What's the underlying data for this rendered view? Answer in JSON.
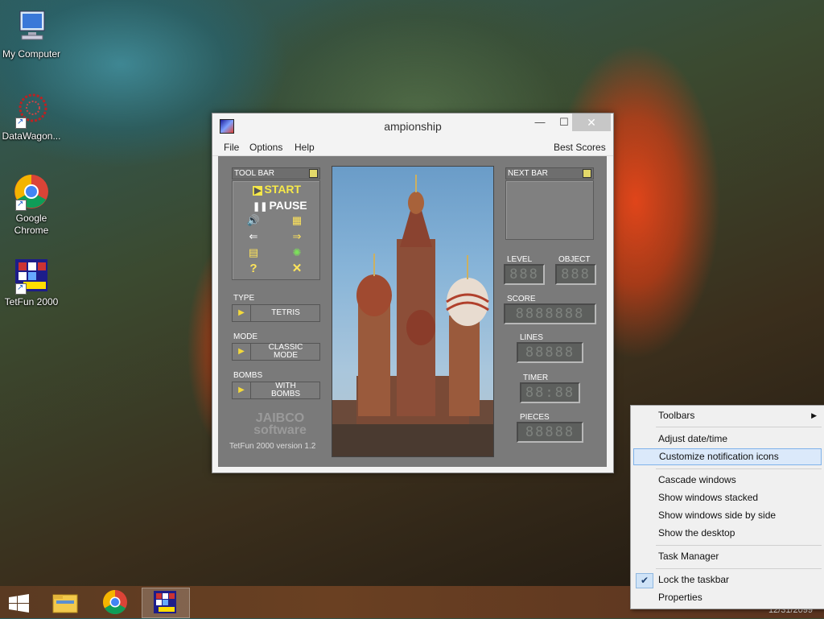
{
  "desktop": {
    "icons": [
      {
        "label": "My Computer"
      },
      {
        "label": "DataWagon..."
      },
      {
        "label": "Google Chrome"
      },
      {
        "label": "TetFun 2000"
      }
    ]
  },
  "window": {
    "title": "ampionship",
    "menu": {
      "file": "File",
      "options": "Options",
      "help": "Help",
      "best_scores": "Best Scores"
    },
    "toolbar": {
      "title": "TOOL BAR",
      "start": "START",
      "pause": "PAUSE"
    },
    "type": {
      "label": "TYPE",
      "value": "TETRIS"
    },
    "mode": {
      "label": "MODE",
      "value_line1": "CLASSIC",
      "value_line2": "MODE"
    },
    "bombs": {
      "label": "BOMBS",
      "value_line1": "WITH",
      "value_line2": "BOMBS"
    },
    "brand_line1": "JAIBCO",
    "brand_line2": "software",
    "version": "TetFun 2000 version 1.2",
    "next_bar": {
      "title": "NEXT BAR"
    },
    "stats": {
      "level_label": "LEVEL",
      "level_value": "888",
      "object_label": "OBJECT",
      "object_value": "888",
      "score_label": "SCORE",
      "score_value": "8888888",
      "lines_label": "LINES",
      "lines_value": "88888",
      "timer_label": "TIMER",
      "timer_value": "88:88",
      "pieces_label": "PIECES",
      "pieces_value": "88888"
    }
  },
  "context_menu": {
    "toolbars": "Toolbars",
    "adjust_datetime": "Adjust date/time",
    "customize_notification": "Customize notification icons",
    "cascade": "Cascade windows",
    "stacked": "Show windows stacked",
    "side_by_side": "Show windows side by side",
    "show_desktop": "Show the desktop",
    "task_manager": "Task Manager",
    "lock_taskbar": "Lock the taskbar",
    "properties": "Properties"
  },
  "taskbar": {
    "clock_date": "12/31/2099"
  }
}
